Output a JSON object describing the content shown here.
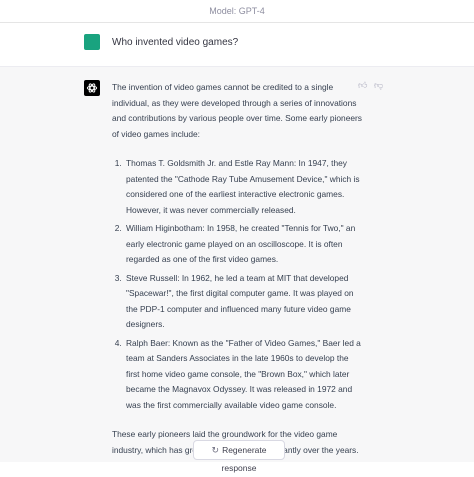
{
  "header": {
    "model_label": "Model: GPT-4"
  },
  "user_message": {
    "text": "Who invented video games?"
  },
  "assistant_message": {
    "intro": "The invention of video games cannot be credited to a single individual, as they were developed through a series of innovations and contributions by various people over time. Some early pioneers of video games include:",
    "items": [
      "Thomas T. Goldsmith Jr. and Estle Ray Mann: In 1947, they patented the \"Cathode Ray Tube Amusement Device,\" which is considered one of the earliest interactive electronic games. However, it was never commercially released.",
      "William Higinbotham: In 1958, he created \"Tennis for Two,\" an early electronic game played on an oscilloscope. It is often regarded as one of the first video games.",
      "Steve Russell: In 1962, he led a team at MIT that developed \"Spacewar!\", the first digital computer game. It was played on the PDP-1 computer and influenced many future video game designers.",
      "Ralph Baer: Known as the \"Father of Video Games,\" Baer led a team at Sanders Associates in the late 1960s to develop the first home video game console, the \"Brown Box,\" which later became the Magnavox Odyssey. It was released in 1972 and was the first commercially available video game console."
    ],
    "conclusion": "These early pioneers laid the groundwork for the video game industry, which has grown and evolved significantly over the years."
  },
  "feedback": {
    "up_icon": "thumbs-up-icon",
    "down_icon": "thumbs-down-icon"
  },
  "regenerate": {
    "label": "Regenerate response",
    "icon": "refresh-icon"
  },
  "colors": {
    "user_avatar": "#19a37f",
    "assistant_bg": "#f7f7f8",
    "text": "#374151"
  }
}
